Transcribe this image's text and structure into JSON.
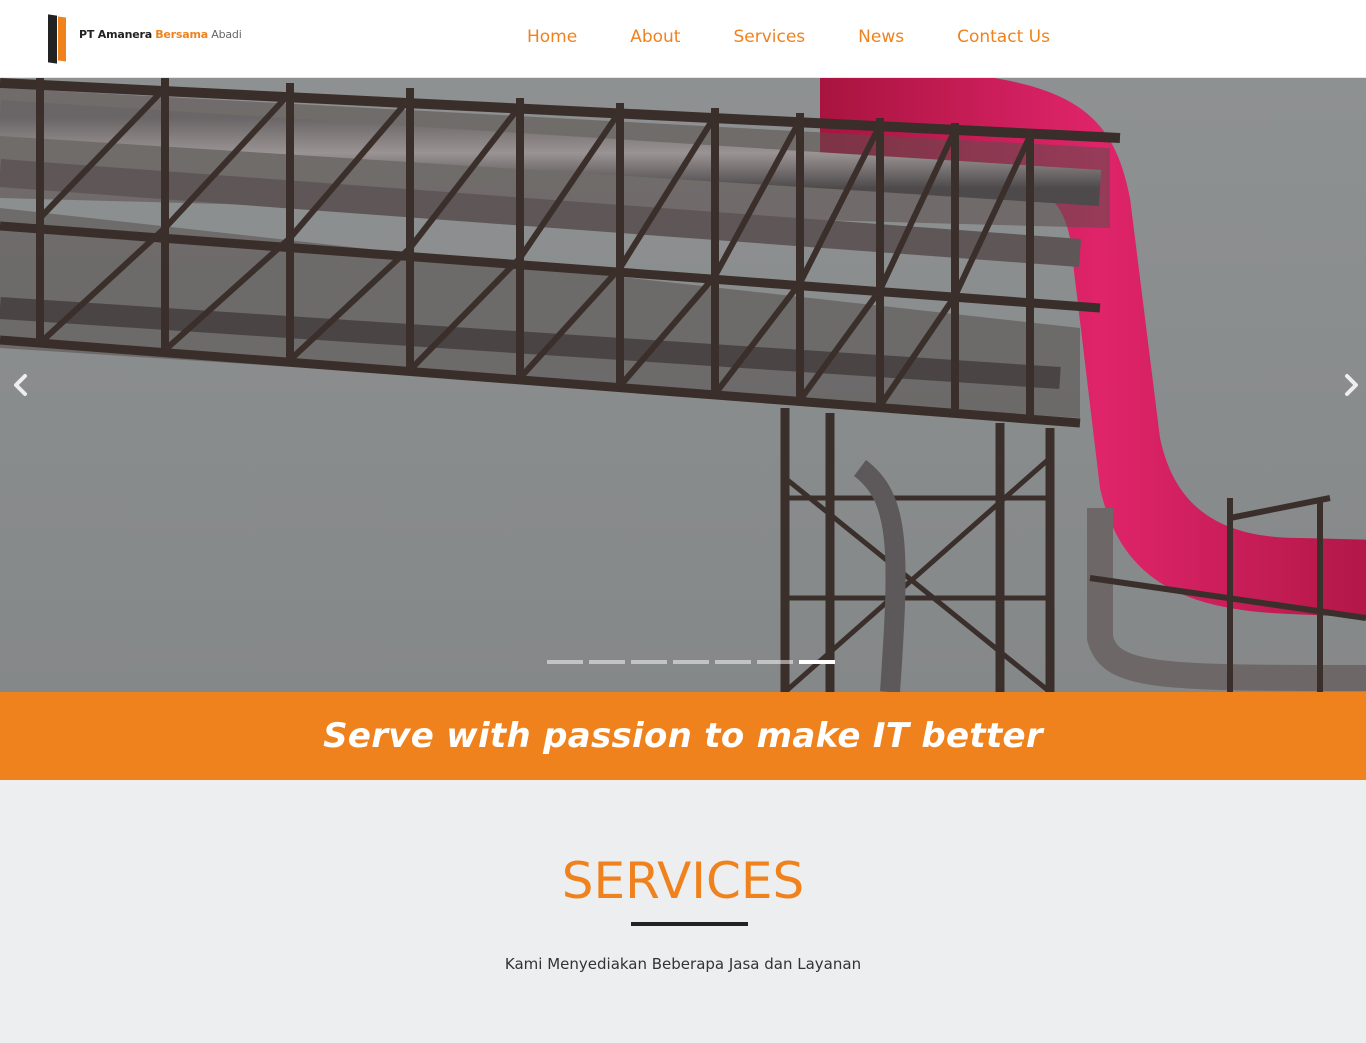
{
  "brand": {
    "word1": "PT Amanera",
    "word2": "Bersama",
    "word3": "Abadi",
    "colors": {
      "accent": "#f0821e",
      "dark": "#222222",
      "white": "#ffffff",
      "background": "#eceeef"
    }
  },
  "nav": {
    "items": [
      {
        "label": "Home"
      },
      {
        "label": "About"
      },
      {
        "label": "Services"
      },
      {
        "label": "News"
      },
      {
        "label": "Contact Us"
      }
    ]
  },
  "slider": {
    "prev_icon": "chevron-left-icon",
    "next_icon": "chevron-right-icon",
    "slide_count": 7,
    "active_slide": 7
  },
  "tagline": {
    "text": "Serve with passion to make IT better"
  },
  "services": {
    "title": "SERVICES",
    "subtitle": "Kami Menyediakan Beberapa Jasa dan Layanan"
  }
}
